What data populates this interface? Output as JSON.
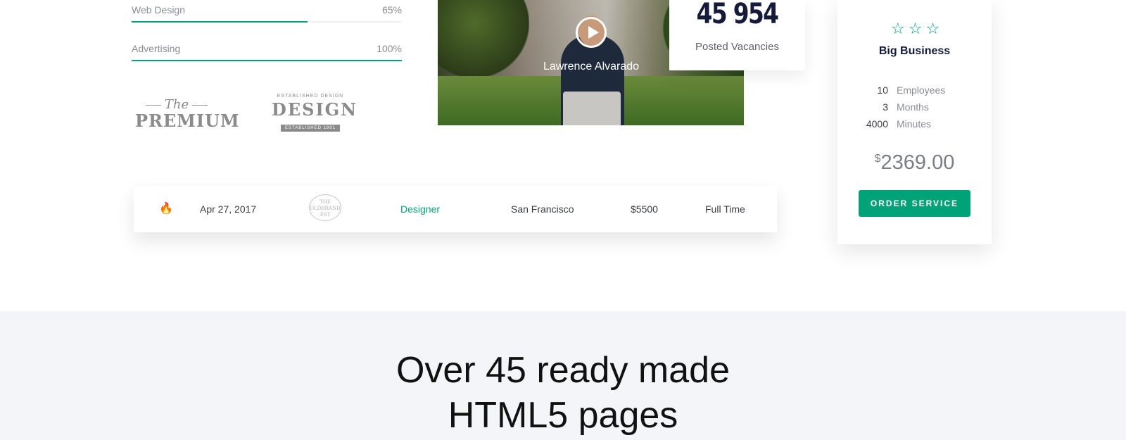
{
  "skills": [
    {
      "label": "Web Design",
      "value": "65%",
      "fraction": 0.65
    },
    {
      "label": "Advertising",
      "value": "100%",
      "fraction": 1.0
    }
  ],
  "logos": {
    "premium": {
      "small": "The",
      "big": "PREMIUM"
    },
    "design": {
      "top": "ESTABLISHED DESIGN",
      "big": "DESIGN",
      "ribbon": "ESTABLISHED 1981"
    }
  },
  "video": {
    "name": "Lawrence Alvarado"
  },
  "stat": {
    "number": "45 954",
    "label": "Posted Vacancies"
  },
  "pricing": {
    "stars": 3,
    "plan": "Big Business",
    "features": [
      {
        "num": "10",
        "label": "Employees"
      },
      {
        "num": "3",
        "label": "Months"
      },
      {
        "num": "4000",
        "label": "Minutes"
      }
    ],
    "currency": "$",
    "amount": "2369.00",
    "button": "ORDER SERVICE",
    "accent": "#00a378"
  },
  "job": {
    "icon": "fire-icon",
    "date": "Apr 27, 2017",
    "brand": {
      "line1": "THE",
      "line2": "OLDBRAND",
      "line3": "EST"
    },
    "role": "Designer",
    "city": "San Francisco",
    "salary": "$5500",
    "type": "Full Time"
  },
  "bottom": {
    "title_line1": "Over 45 ready made",
    "title_line2": "HTML5 pages"
  }
}
